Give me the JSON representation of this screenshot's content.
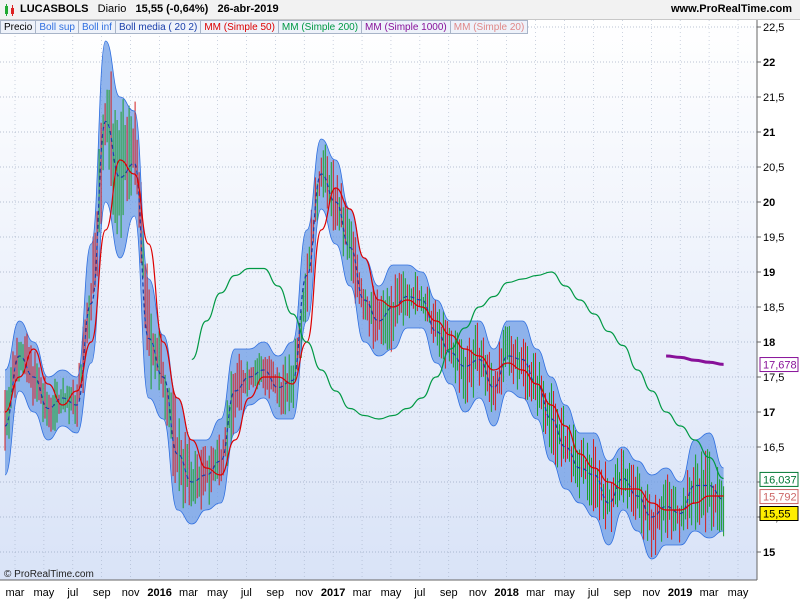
{
  "header": {
    "ticker": "LUCASBOLS",
    "period": "Diario",
    "price": "15,55 (-0,64%)",
    "date": "26-abr-2019",
    "site": "www.ProRealTime.com"
  },
  "legend": [
    {
      "label": "Precio",
      "color": "#000000"
    },
    {
      "label": "Boll sup",
      "color": "#2f6fe0"
    },
    {
      "label": "Boll inf",
      "color": "#2f6fe0"
    },
    {
      "label": "Boll media ( 20 2)",
      "color": "#1a3faa"
    },
    {
      "label": "MM (Simple 50)",
      "color": "#dd0000"
    },
    {
      "label": "MM (Simple 200)",
      "color": "#009944"
    },
    {
      "label": "MM (Simple 1000)",
      "color": "#881199"
    },
    {
      "label": "MM (Simple 20)",
      "color": "#e08888"
    }
  ],
  "copyright": "© ProRealTime.com",
  "chart_data": {
    "type": "line",
    "y_axis_side": "right",
    "ylim": [
      14.6,
      22.6
    ],
    "yticks": [
      "15",
      "15,5",
      "16",
      "16,5",
      "17",
      "17,5",
      "18",
      "18,5",
      "19",
      "19,5",
      "20",
      "20,5",
      "21",
      "21,5",
      "22",
      "22,5"
    ],
    "xticks": [
      "mar",
      "may",
      "jul",
      "sep",
      "nov",
      "2016",
      "mar",
      "may",
      "jul",
      "sep",
      "nov",
      "2017",
      "mar",
      "may",
      "jul",
      "sep",
      "nov",
      "2018",
      "mar",
      "may",
      "jul",
      "sep",
      "nov",
      "2019",
      "mar",
      "may"
    ],
    "value_labels": [
      {
        "text": "17,678",
        "value": 17.678,
        "series": "MM (Simple 1000)",
        "color": "#881199",
        "bg": "#ffffff"
      },
      {
        "text": "16,037",
        "value": 16.037,
        "series": "MM (Simple 200)",
        "color": "#007733",
        "bg": "#ffffff"
      },
      {
        "text": "15,792",
        "value": 15.792,
        "series": "MM (Simple 20)",
        "color": "#cc6666",
        "bg": "#ffffff"
      },
      {
        "text": "15,55",
        "value": 15.55,
        "series": "Precio",
        "color": "#000000",
        "bg": "#ffee00"
      }
    ],
    "series": [
      {
        "name": "Precio",
        "color": "#000000",
        "x": [
          0,
          1,
          2,
          3,
          4,
          5,
          6,
          7,
          8,
          9,
          10,
          11,
          12,
          13,
          14,
          15,
          16,
          17,
          18,
          19,
          20,
          21,
          22,
          23,
          24,
          25,
          26,
          27,
          28,
          29,
          30,
          31,
          32,
          33,
          34,
          35,
          36,
          37,
          38,
          39,
          40,
          41,
          42,
          43,
          44,
          45,
          46,
          47,
          48,
          49,
          50
        ],
        "values": [
          16.9,
          17.9,
          17.5,
          17.0,
          17.2,
          17.1,
          18.6,
          21.2,
          20.4,
          20.9,
          18.1,
          17.5,
          16.4,
          16.0,
          16.1,
          16.3,
          17.3,
          17.5,
          17.6,
          17.3,
          17.4,
          18.9,
          20.5,
          20.0,
          19.4,
          18.5,
          18.3,
          18.4,
          18.7,
          18.6,
          18.2,
          17.9,
          17.6,
          17.8,
          17.3,
          17.9,
          17.7,
          17.4,
          16.9,
          16.5,
          16.2,
          16.1,
          15.7,
          16.1,
          15.8,
          15.4,
          15.7,
          15.5,
          15.9,
          15.9,
          15.55
        ]
      },
      {
        "name": "Boll sup",
        "color": "#2f6fe0",
        "x": [
          0,
          1,
          2,
          3,
          4,
          5,
          6,
          7,
          8,
          9,
          10,
          11,
          12,
          13,
          14,
          15,
          16,
          17,
          18,
          19,
          20,
          21,
          22,
          23,
          24,
          25,
          26,
          27,
          28,
          29,
          30,
          31,
          32,
          33,
          34,
          35,
          36,
          37,
          38,
          39,
          40,
          41,
          42,
          43,
          44,
          45,
          46,
          47,
          48,
          49,
          50
        ],
        "values": [
          17.6,
          18.3,
          18.0,
          17.5,
          17.6,
          17.5,
          19.4,
          22.3,
          21.5,
          21.3,
          18.9,
          18.1,
          17.2,
          16.6,
          16.6,
          16.9,
          17.9,
          17.9,
          18.0,
          17.8,
          18.0,
          19.6,
          20.9,
          20.6,
          19.9,
          19.2,
          18.8,
          19.1,
          19.1,
          19.0,
          18.6,
          18.3,
          18.3,
          18.3,
          17.9,
          18.3,
          18.3,
          17.9,
          17.5,
          17.1,
          16.7,
          16.7,
          16.3,
          16.5,
          16.3,
          16.1,
          16.2,
          16.0,
          16.6,
          16.7,
          16.2
        ]
      },
      {
        "name": "Boll inf",
        "color": "#2f6fe0",
        "x": [
          0,
          1,
          2,
          3,
          4,
          5,
          6,
          7,
          8,
          9,
          10,
          11,
          12,
          13,
          14,
          15,
          16,
          17,
          18,
          19,
          20,
          21,
          22,
          23,
          24,
          25,
          26,
          27,
          28,
          29,
          30,
          31,
          32,
          33,
          34,
          35,
          36,
          37,
          38,
          39,
          40,
          41,
          42,
          43,
          44,
          45,
          46,
          47,
          48,
          49,
          50
        ],
        "values": [
          16.1,
          17.3,
          17.0,
          16.6,
          16.8,
          16.7,
          17.7,
          20.0,
          19.2,
          19.8,
          17.2,
          16.9,
          15.6,
          15.4,
          15.6,
          15.7,
          16.7,
          17.1,
          17.2,
          16.9,
          16.9,
          18.3,
          19.9,
          19.4,
          18.8,
          18.0,
          17.8,
          17.9,
          18.2,
          18.2,
          17.7,
          17.4,
          17.0,
          17.2,
          16.8,
          17.3,
          17.2,
          16.9,
          16.3,
          15.9,
          15.7,
          15.5,
          15.1,
          15.6,
          15.3,
          14.9,
          15.1,
          15.1,
          15.3,
          15.2,
          15.3
        ]
      },
      {
        "name": "Boll media ( 20 2)",
        "color": "#1a3faa",
        "x": [
          0,
          1,
          2,
          3,
          4,
          5,
          6,
          7,
          8,
          9,
          10,
          11,
          12,
          13,
          14,
          15,
          16,
          17,
          18,
          19,
          20,
          21,
          22,
          23,
          24,
          25,
          26,
          27,
          28,
          29,
          30,
          31,
          32,
          33,
          34,
          35,
          36,
          37,
          38,
          39,
          40,
          41,
          42,
          43,
          44,
          45,
          46,
          47,
          48,
          49,
          50
        ],
        "values": [
          16.8,
          17.8,
          17.5,
          17.05,
          17.2,
          17.1,
          18.55,
          21.15,
          20.35,
          20.55,
          18.05,
          17.5,
          16.4,
          16.0,
          16.1,
          16.3,
          17.3,
          17.5,
          17.6,
          17.35,
          17.45,
          18.95,
          20.4,
          20.0,
          19.35,
          18.6,
          18.3,
          18.5,
          18.65,
          18.6,
          18.15,
          17.85,
          17.65,
          17.75,
          17.35,
          17.8,
          17.75,
          17.4,
          16.9,
          16.5,
          16.2,
          16.1,
          15.7,
          16.05,
          15.8,
          15.5,
          15.65,
          15.55,
          15.95,
          15.95,
          15.75
        ]
      },
      {
        "name": "MM (Simple 50)",
        "color": "#dd0000",
        "x": [
          0,
          1,
          2,
          3,
          4,
          5,
          6,
          7,
          8,
          9,
          10,
          11,
          12,
          13,
          14,
          15,
          16,
          17,
          18,
          19,
          20,
          21,
          22,
          23,
          24,
          25,
          26,
          27,
          28,
          29,
          30,
          31,
          32,
          33,
          34,
          35,
          36,
          37,
          38,
          39,
          40,
          41,
          42,
          43,
          44,
          45,
          46,
          47,
          48,
          49,
          50
        ],
        "values": [
          17.0,
          17.5,
          17.9,
          17.4,
          17.1,
          17.3,
          18.0,
          19.6,
          20.6,
          20.4,
          19.4,
          18.0,
          17.2,
          16.6,
          16.2,
          16.1,
          16.6,
          17.2,
          17.5,
          17.5,
          17.4,
          18.0,
          19.6,
          20.2,
          19.9,
          19.2,
          18.6,
          18.5,
          18.6,
          18.5,
          18.3,
          18.1,
          17.9,
          17.8,
          17.6,
          17.7,
          17.6,
          17.4,
          17.1,
          16.8,
          16.4,
          16.2,
          16.0,
          15.9,
          15.9,
          15.7,
          15.6,
          15.6,
          15.7,
          15.8,
          15.8
        ]
      },
      {
        "name": "MM (Simple 200)",
        "color": "#009944",
        "x": [
          13,
          14,
          15,
          16,
          17,
          18,
          19,
          20,
          21,
          22,
          23,
          24,
          25,
          26,
          27,
          28,
          29,
          30,
          31,
          32,
          33,
          34,
          35,
          36,
          37,
          38,
          39,
          40,
          41,
          42,
          43,
          44,
          45,
          46,
          47,
          48,
          49,
          50
        ],
        "values": [
          17.75,
          18.3,
          18.7,
          18.95,
          19.05,
          19.05,
          18.8,
          18.4,
          18.0,
          17.6,
          17.3,
          17.05,
          16.95,
          16.9,
          16.95,
          17.05,
          17.2,
          17.5,
          17.9,
          18.2,
          18.5,
          18.65,
          18.85,
          18.9,
          18.95,
          19.0,
          18.8,
          18.6,
          18.4,
          18.15,
          17.95,
          17.6,
          17.3,
          17.0,
          16.8,
          16.6,
          16.35,
          16.05
        ]
      },
      {
        "name": "MM (Simple 1000)",
        "color": "#881199",
        "x": [
          46,
          47,
          48,
          49,
          50
        ],
        "values": [
          17.8,
          17.78,
          17.74,
          17.71,
          17.68
        ]
      }
    ]
  }
}
